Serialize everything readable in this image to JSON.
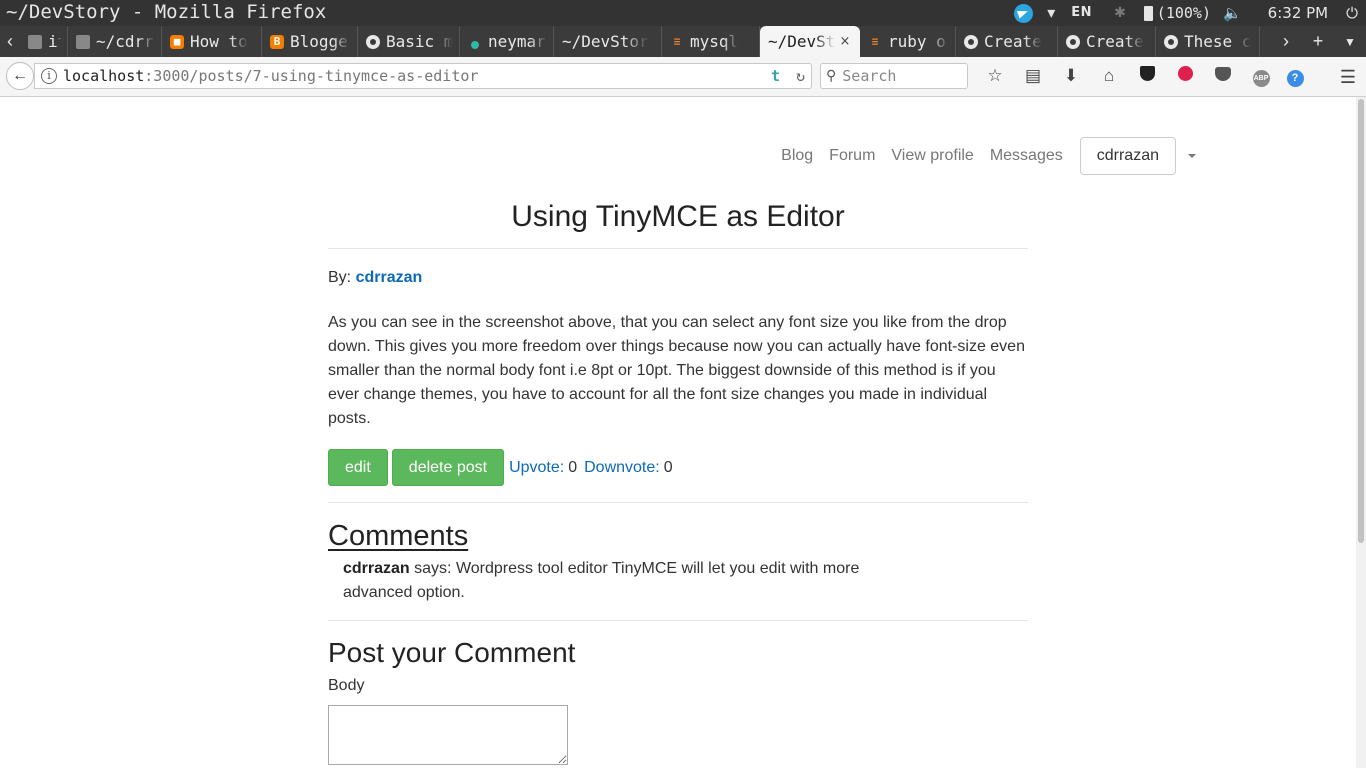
{
  "os": {
    "window_title": "~/DevStory - Mozilla Firefox",
    "language": "EN",
    "battery": "(100%)",
    "clock": "6:32 PM"
  },
  "tabs": [
    {
      "label": "ital",
      "icon": "page-icon",
      "active": false
    },
    {
      "label": "~/cdrra",
      "icon": "page-icon",
      "active": false
    },
    {
      "label": "How to",
      "icon": "orange-site-icon",
      "active": false
    },
    {
      "label": "Blogger",
      "icon": "blogger-icon",
      "active": false
    },
    {
      "label": "Basic m",
      "icon": "github-icon",
      "active": false
    },
    {
      "label": "neymars",
      "icon": "dot-icon",
      "active": false
    },
    {
      "label": "~/DevStor",
      "icon": "none",
      "active": false
    },
    {
      "label": "mysql",
      "icon": "stackoverflow-icon",
      "active": false
    },
    {
      "label": "~/DevSt",
      "icon": "none",
      "active": true
    },
    {
      "label": "ruby or",
      "icon": "stackoverflow-icon",
      "active": false
    },
    {
      "label": "Create",
      "icon": "github-icon",
      "active": false
    },
    {
      "label": "Create",
      "icon": "github-icon",
      "active": false
    },
    {
      "label": "These c",
      "icon": "github-icon",
      "active": false
    }
  ],
  "url": {
    "host": "localhost",
    "path": ":3000/posts/7-using-tinymce-as-editor"
  },
  "search": {
    "placeholder": "Search"
  },
  "nav": {
    "blog": "Blog",
    "forum": "Forum",
    "view_profile": "View profile",
    "messages": "Messages",
    "user": "cdrrazan"
  },
  "post": {
    "title": "Using TinyMCE as Editor",
    "by_label": "By:",
    "author": "cdrrazan",
    "body": "As you can see in the screenshot above, that you can select any font size you like from the drop down. This gives you more freedom over things because now you can actually have font-size even smaller than the normal body font i.e 8pt or 10pt. The biggest downside of this method is if you ever change themes, you have to account for all the font size changes you made in individual posts.",
    "edit_label": "edit",
    "delete_label": "delete post",
    "upvote_label": "Upvote:",
    "upvote_count": "0",
    "downvote_label": "Downvote:",
    "downvote_count": "0"
  },
  "comments": {
    "title": "Comments",
    "items": [
      {
        "author": "cdrrazan",
        "says": "says: Wordpress tool editor TinyMCE will let you edit with more advanced option."
      }
    ]
  },
  "comment_form": {
    "title": "Post your Comment",
    "body_label": "Body",
    "body_value": ""
  }
}
